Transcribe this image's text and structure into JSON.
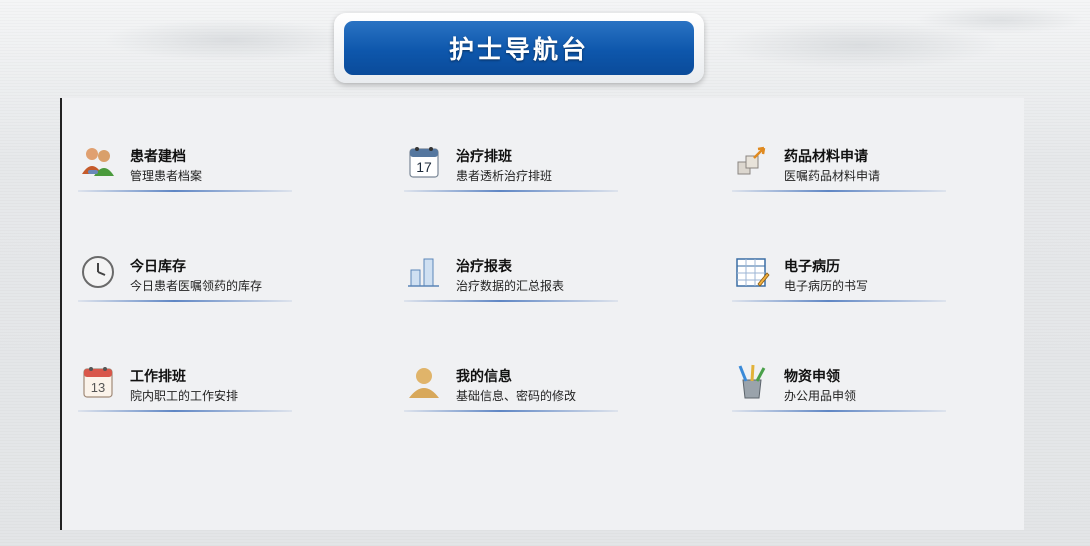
{
  "header": {
    "title": "护士导航台"
  },
  "tiles": [
    {
      "title": "患者建档",
      "subtitle": "管理患者档案",
      "icon": "patients-icon"
    },
    {
      "title": "治疗排班",
      "subtitle": "患者透析治疗排班",
      "icon": "calendar-17-icon"
    },
    {
      "title": "药品材料申请",
      "subtitle": "医嘱药品材料申请",
      "icon": "boxes-request-icon"
    },
    {
      "title": "今日库存",
      "subtitle": "今日患者医嘱领药的库存",
      "icon": "clock-icon"
    },
    {
      "title": "治疗报表",
      "subtitle": "治疗数据的汇总报表",
      "icon": "bar-chart-icon"
    },
    {
      "title": "电子病历",
      "subtitle": "电子病历的书写",
      "icon": "spreadsheet-pen-icon"
    },
    {
      "title": "工作排班",
      "subtitle": "院内职工的工作安排",
      "icon": "calendar-13-icon"
    },
    {
      "title": "我的信息",
      "subtitle": "基础信息、密码的修改",
      "icon": "user-icon"
    },
    {
      "title": "物资申领",
      "subtitle": "办公用品申领",
      "icon": "pen-cup-icon"
    }
  ]
}
